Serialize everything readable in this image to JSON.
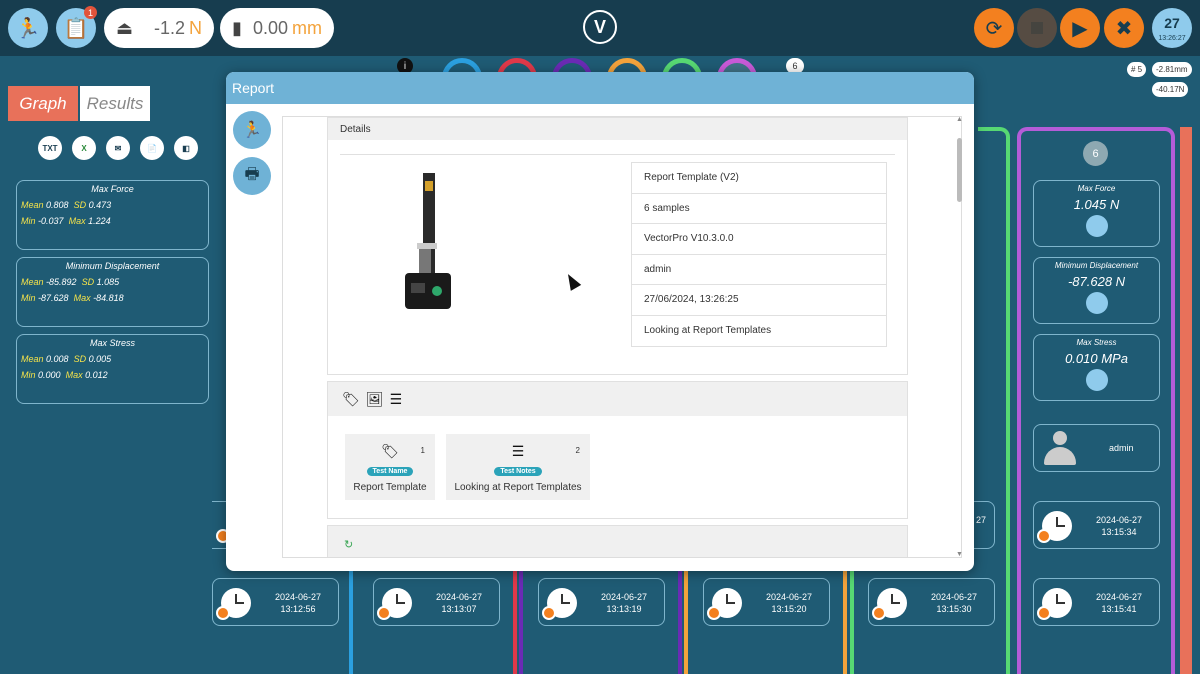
{
  "toolbar": {
    "badge_count": "1",
    "force_value": "-1.2",
    "force_unit": "N",
    "disp_value": "0.00",
    "disp_unit": "mm",
    "calendar_day": "27",
    "calendar_time": "13:26:27",
    "logo_glyph": "V"
  },
  "samples": {
    "info_glyph": "i",
    "count": "6",
    "sample_pill": "# 5",
    "disp_pill": "-2.81mm",
    "force_pill": "-40.17N",
    "colors": [
      "#2ba0e0",
      "#e0394a",
      "#6a2bb5",
      "#f3a33c",
      "#57d873",
      "#c85ad8"
    ]
  },
  "left": {
    "tab_graph": "Graph",
    "tab_results": "Results",
    "export_icons": [
      "TXT",
      "X",
      "✉",
      "📄",
      "◧"
    ],
    "stats": [
      {
        "title": "Max Force",
        "mean": "0.808",
        "sd": "0.473",
        "min": "-0.037",
        "max": "1.224"
      },
      {
        "title": "Minimum Displacement",
        "mean": "-85.892",
        "sd": "1.085",
        "min": "-87.628",
        "max": "-84.818"
      },
      {
        "title": "Max Stress",
        "mean": "0.008",
        "sd": "0.005",
        "min": "0.000",
        "max": "0.012"
      }
    ],
    "labels": {
      "mean": "Mean",
      "sd": "SD",
      "min": "Min",
      "max": "Max"
    }
  },
  "runs": [
    {
      "date": "2024-06-27",
      "time": "13:12:56"
    },
    {
      "date": "2024-06-27",
      "time": "13:13:07"
    },
    {
      "date": "2024-06-27",
      "time": "13:13:19"
    },
    {
      "date": "2024-06-27",
      "time": "13:15:20"
    },
    {
      "date": "2024-06-27",
      "time": "13:15:30"
    },
    {
      "date": "2024-06-27",
      "time": "13:15:41"
    }
  ],
  "right_col": {
    "sample_num": "6",
    "results": [
      {
        "title": "Max Force",
        "value": "1.045 N"
      },
      {
        "title": "Minimum Displacement",
        "value": "-87.628 N"
      },
      {
        "title": "Max Stress",
        "value": "0.010 MPa"
      }
    ],
    "user": "admin",
    "run": {
      "date": "2024-06-27",
      "time": "13:15:34"
    },
    "partial_run_label": "27"
  },
  "modal": {
    "title": "Report",
    "details_header": "Details",
    "details": [
      "Report Template (V2)",
      "6 samples",
      "VectorPro V10.3.0.0",
      "admin",
      "27/06/2024, 13:26:25",
      "Looking at Report Templates"
    ],
    "tiles": [
      {
        "num": "1",
        "badge": "Test Name",
        "label": "Report Template"
      },
      {
        "num": "2",
        "badge": "Test Notes",
        "label": "Looking at Report Templates"
      }
    ]
  }
}
